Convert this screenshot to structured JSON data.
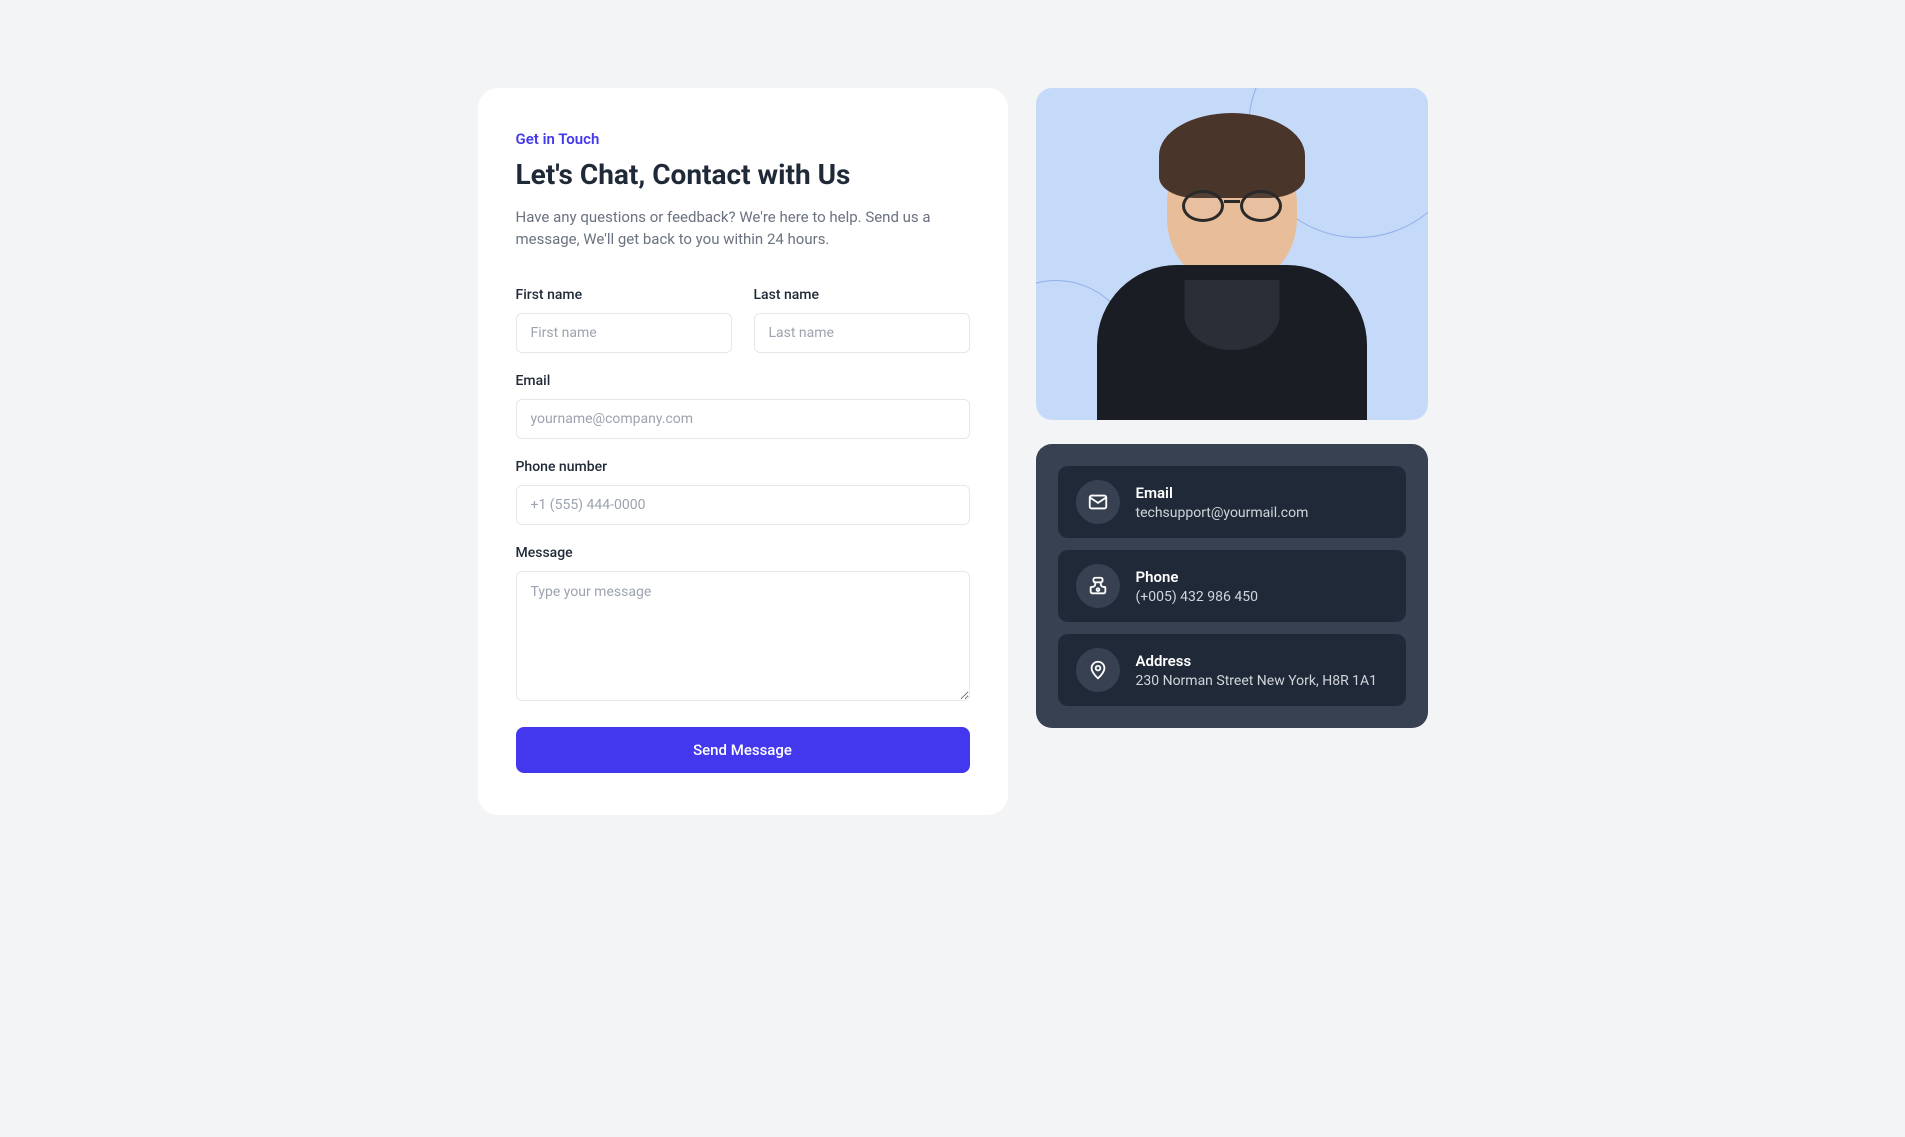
{
  "form": {
    "eyebrow": "Get in Touch",
    "heading": "Let's Chat, Contact with Us",
    "description": "Have any questions or feedback? We're here to help. Send us a message, We'll get back to you within 24 hours.",
    "fields": {
      "firstName": {
        "label": "First name",
        "placeholder": "First name"
      },
      "lastName": {
        "label": "Last name",
        "placeholder": "Last name"
      },
      "email": {
        "label": "Email",
        "placeholder": "yourname@company.com"
      },
      "phone": {
        "label": "Phone number",
        "placeholder": "+1 (555) 444-0000"
      },
      "message": {
        "label": "Message",
        "placeholder": "Type your message"
      }
    },
    "submitLabel": "Send Message"
  },
  "contact": {
    "items": [
      {
        "icon": "mail",
        "label": "Email",
        "value": "techsupport@yourmail.com"
      },
      {
        "icon": "phone",
        "label": "Phone",
        "value": "(+005) 432 986 450"
      },
      {
        "icon": "map-pin",
        "label": "Address",
        "value": "230 Norman Street New York, H8R 1A1"
      }
    ]
  }
}
